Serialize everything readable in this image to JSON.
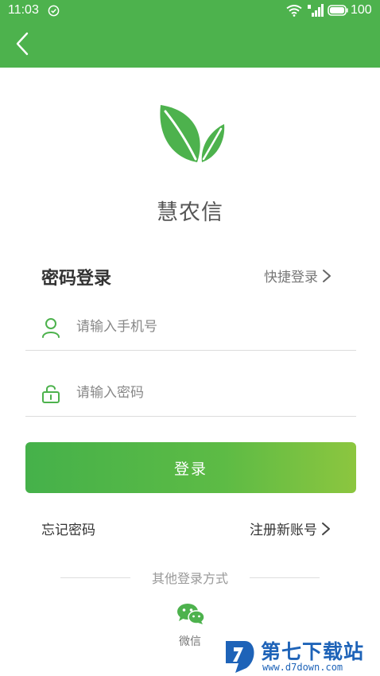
{
  "status_bar": {
    "time": "11:03",
    "battery": "100"
  },
  "app": {
    "name": "慧农信",
    "brand_color": "#4db24d"
  },
  "login": {
    "title": "密码登录",
    "quick_login": "快捷登录",
    "phone_placeholder": "请输入手机号",
    "password_placeholder": "请输入密码",
    "submit_label": "登录",
    "forgot_password": "忘记密码",
    "register": "注册新账号"
  },
  "other_login": {
    "title": "其他登录方式",
    "wechat_label": "微信"
  },
  "watermark": {
    "brand": "第七下载站",
    "url": "www.d7down.com"
  },
  "icons": {
    "back": "back-arrow-icon",
    "phone": "user-icon",
    "password": "lock-icon",
    "wechat": "wechat-icon"
  }
}
